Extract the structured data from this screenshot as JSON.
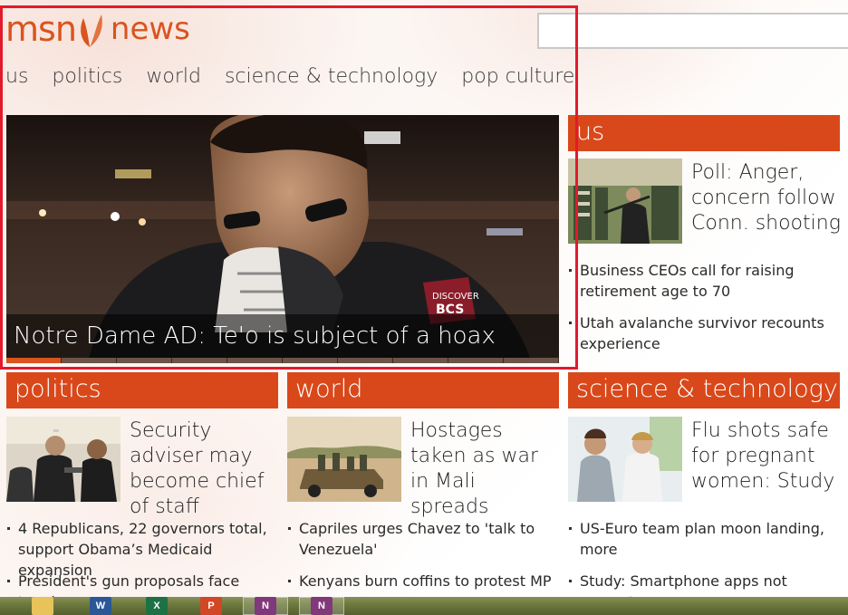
{
  "brand": {
    "logo_text": "msn",
    "section": "news",
    "accent": "#d9541e"
  },
  "search": {
    "placeholder": "",
    "value": ""
  },
  "nav": {
    "items": [
      "us",
      "politics",
      "world",
      "science & technology",
      "pop culture"
    ]
  },
  "hero": {
    "caption": "Notre Dame AD: Te'o is subject of a hoax",
    "slide_count": 10,
    "active_slide": 1
  },
  "sections": {
    "us": {
      "header": "us",
      "feature": "Poll: Anger, concern follow Conn. shooting",
      "bullets": [
        "Business CEOs call for raising retirement age to 70",
        "Utah avalanche survivor recounts experience"
      ]
    },
    "politics": {
      "header": "politics",
      "feature": "Security adviser may become chief of staff",
      "bullets": [
        "4 Republicans, 22 governors total, support Obama’s Medicaid expansion",
        "President's gun proposals face tough"
      ]
    },
    "world": {
      "header": "world",
      "feature": "Hostages taken as war in Mali spreads",
      "bullets": [
        "Capriles urges Chavez to 'talk to Venezuela'",
        "Kenyans burn coffins to protest MP"
      ]
    },
    "scitech": {
      "header": "science & technology",
      "feature": "Flu shots safe for pregnant women: Study",
      "bullets": [
        "US-Euro team plan moon landing, more",
        "Study: Smartphone apps not accurate"
      ]
    }
  },
  "taskbar": {
    "apps": [
      {
        "name": "file-explorer-icon",
        "letter": "",
        "color": "#e8c25a"
      },
      {
        "name": "word-icon",
        "letter": "W",
        "color": "#2b5797"
      },
      {
        "name": "excel-icon",
        "letter": "X",
        "color": "#1e7145"
      },
      {
        "name": "powerpoint-icon",
        "letter": "P",
        "color": "#d24726"
      },
      {
        "name": "onenote-icon",
        "letter": "N",
        "color": "#80397b"
      },
      {
        "name": "onenote-icon-2",
        "letter": "N",
        "color": "#80397b"
      }
    ]
  }
}
